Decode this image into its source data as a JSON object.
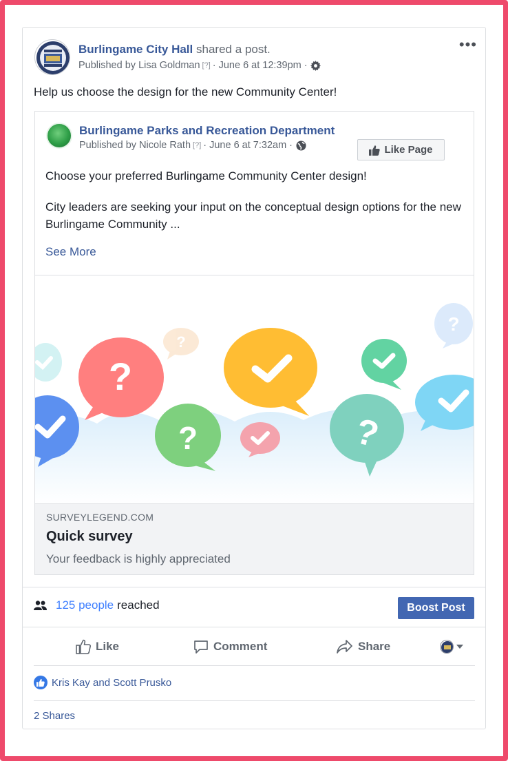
{
  "post": {
    "author": "Burlingame City Hall",
    "shared_text": "shared a",
    "post_link": "post.",
    "publisher_prefix": "Published by",
    "publisher": "Lisa Goldman",
    "help_mark": "[?]",
    "date": "· June 6 at 12:39pm ·",
    "message": "Help us choose the design for the new Community Center!",
    "more_label": "•••"
  },
  "shared": {
    "page_name": "Burlingame Parks and Recreation Department",
    "publisher_prefix": "Published by",
    "publisher": "Nicole Rath",
    "help_mark": "[?]",
    "date": "· June 6 at 7:32am ·",
    "like_page_label": "Like Page",
    "text1": "Choose your preferred Burlingame Community Center design!",
    "text2": "City leaders are seeking your input on the conceptual design options for the new Burlingame Community ...",
    "see_more": "See More",
    "link": {
      "domain": "SURVEYLEGEND.COM",
      "title": "Quick survey",
      "description": "Your feedback is highly appreciated"
    }
  },
  "reach": {
    "people": "125 people",
    "suffix": "reached",
    "boost_label": "Boost Post"
  },
  "actions": {
    "like": "Like",
    "comment": "Comment",
    "share": "Share"
  },
  "likers": "Kris Kay and Scott Prusko",
  "shares": "2 Shares",
  "colors": {
    "frame": "#ee4a6b",
    "link_blue": "#385898",
    "boost_blue": "#4267b2",
    "reach_blue": "#4080ff"
  }
}
